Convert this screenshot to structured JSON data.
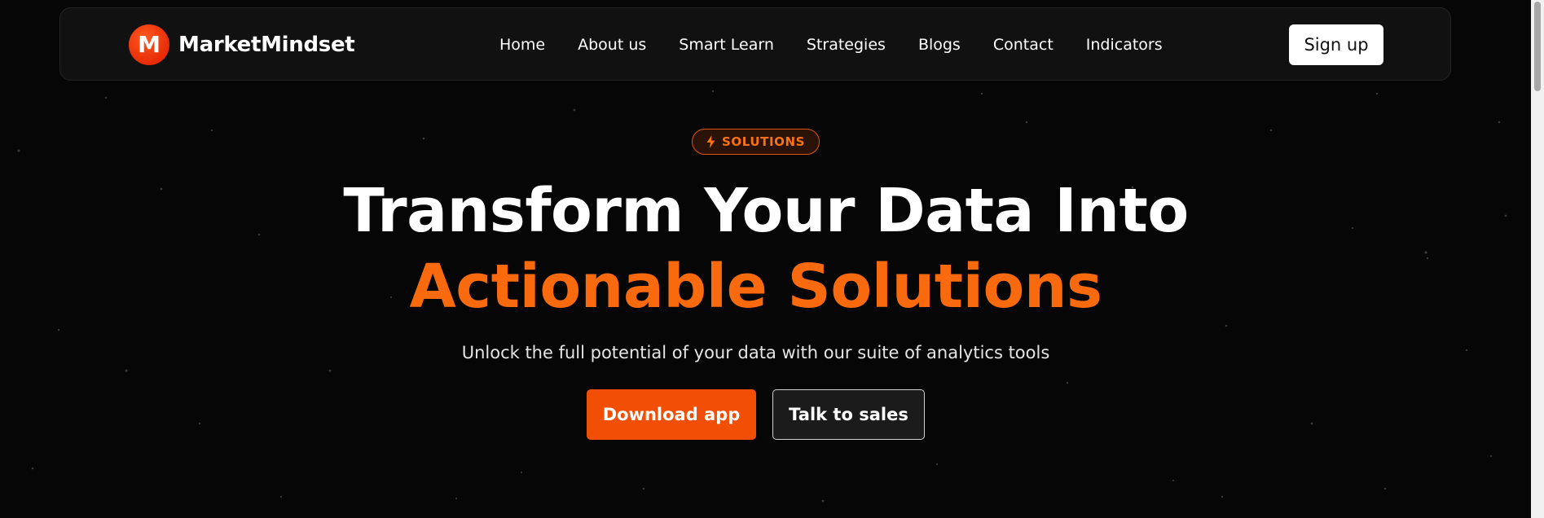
{
  "brand": {
    "logo_letter": "M",
    "name": "MarketMindset"
  },
  "nav": {
    "links": [
      "Home",
      "About us",
      "Smart Learn",
      "Strategies",
      "Blogs",
      "Contact",
      "Indicators"
    ],
    "signup_label": "Sign up"
  },
  "hero": {
    "badge_icon": "lightning-bolt-icon",
    "badge_label": "SOLUTIONS",
    "headline": "Transform Your Data Into",
    "headline_accent": "Actionable Solutions",
    "subtitle": "Unlock the full potential of your data with our suite of analytics tools",
    "primary_button": "Download app",
    "secondary_button": "Talk to sales"
  },
  "colors": {
    "background": "#060606",
    "accent": "#f96a0e",
    "primary_button": "#f24f06",
    "logo": "#e62b06"
  }
}
